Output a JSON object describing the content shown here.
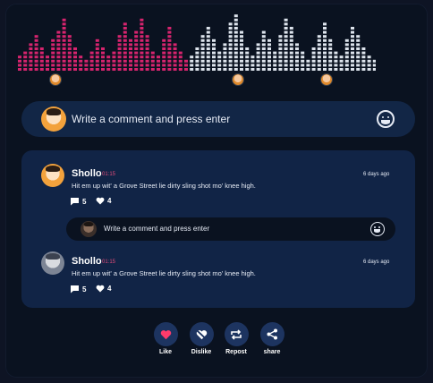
{
  "colors": {
    "wave_played": "#d6246e",
    "wave_unplayed": "#dde3ec",
    "like_accent": "#ff3b6b",
    "timestamp": "#e04a78"
  },
  "composer": {
    "placeholder": "Write a comment and press enter",
    "emoji_icon": "smiley-icon"
  },
  "comments": [
    {
      "user": "Shollo",
      "time": "01:15",
      "age": "6 days ago",
      "text": "Hit em up wit' a Grove Street lie dirty sling shot mo' knee high.",
      "replies": "5",
      "likes": "4"
    },
    {
      "user": "Shollo",
      "time": "01:15",
      "age": "6 days ago",
      "text": "Hit em up wit' a Grove Street lie dirty sling shot mo' knee high.",
      "replies": "5",
      "likes": "4"
    }
  ],
  "reply": {
    "placeholder": "Write a comment and press enter"
  },
  "actions": {
    "like": "Like",
    "dislike": "Dislike",
    "repost": "Repost",
    "share": "share"
  }
}
